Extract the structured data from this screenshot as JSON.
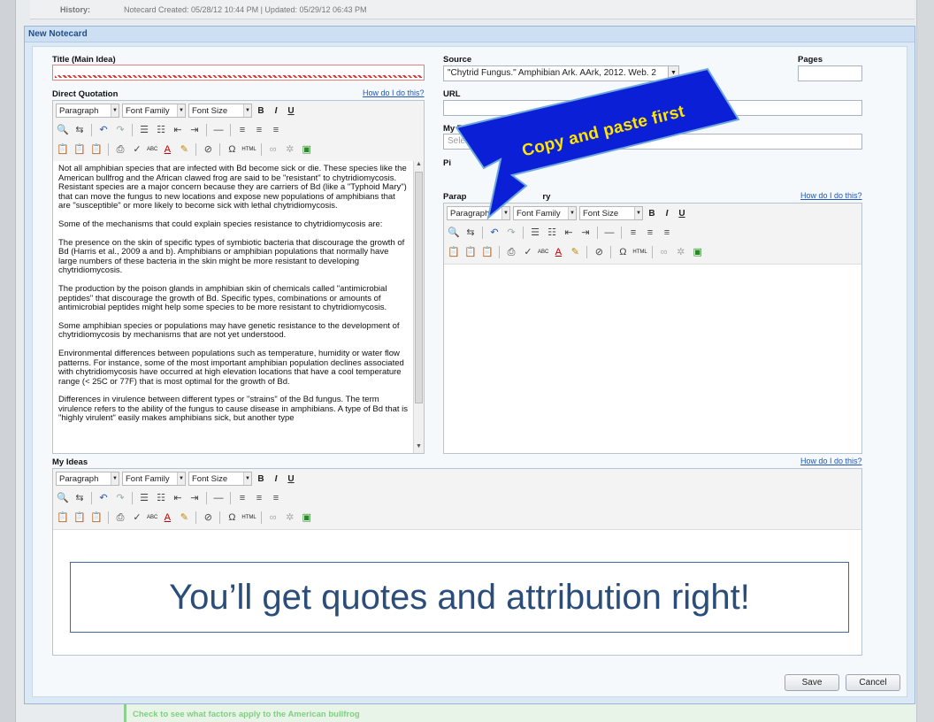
{
  "history": {
    "label": "History:",
    "text": "Notecard Created: 05/28/12 10:44 PM | Updated: 05/29/12 06:43 PM"
  },
  "modal": {
    "title": "New Notecard"
  },
  "title_field": {
    "label": "Title (Main Idea)",
    "value": ""
  },
  "direct_quotation": {
    "label": "Direct Quotation",
    "help": "How do I do this?",
    "paragraphs": [
      "Not all amphibian species that are infected with Bd become sick or die. These species like the American bullfrog and the African clawed frog are said to be \"resistant\" to chytridiomycosis. Resistant species are a major concern because they are carriers of Bd (like a \"Typhoid Mary\") that can move the fungus to new locations and expose new populations of amphibians that are \"susceptible\" or more likely to become sick with lethal chytridiomycosis.",
      "Some of the mechanisms that could explain species resistance to chytridiomycosis are:",
      "The presence on the skin of specific types of symbiotic bacteria that discourage the growth of Bd (Harris et al., 2009 a and b). Amphibians or amphibian populations that normally have large numbers of these bacteria in the skin might be more resistant to developing chytridiomycosis.",
      "The production by the poison glands in amphibian skin of chemicals called \"antimicrobial peptides\" that discourage the growth of Bd. Specific types, combinations or amounts of antimicrobial peptides might help some species to be more resistant to chytridiomycosis.",
      "Some amphibian species or populations may have genetic resistance to the development of chytridiomycosis by mechanisms that are not yet understood.",
      "Environmental differences between populations such as temperature, humidity or water flow patterns. For instance, some of the most important amphibian population declines associated with chytridiomycosis have occurred at high elevation locations that have a cool temperature range (< 25C or 77F) that is most optimal for the growth of Bd.",
      "Differences in virulence between different types or \"strains\" of the Bd fungus. The term virulence refers to the ability of the fungus to cause disease in amphibians. A type of Bd that is \"highly virulent\" easily makes amphibians sick, but another type"
    ]
  },
  "toolbar": {
    "format": "Paragraph",
    "font_family": "Font Family",
    "font_size": "Font Size",
    "bold": "B",
    "italic": "I",
    "underline": "U",
    "html": "HTML",
    "abc": "ABC"
  },
  "source": {
    "label": "Source",
    "value": "\"Chytrid Fungus.\" Amphibian Ark. AArk, 2012. Web. 2"
  },
  "pages": {
    "label": "Pages",
    "value": ""
  },
  "url": {
    "label": "URL",
    "value": ""
  },
  "tags": {
    "label": "My Tags",
    "placeholder": "Sele"
  },
  "pile": {
    "label": "Pi"
  },
  "paraphrase": {
    "label": "Parap",
    "label_tail": "ry",
    "help": "How do I do this?"
  },
  "my_ideas": {
    "label": "My Ideas",
    "help": "How do I do this?"
  },
  "annotations": {
    "arrow_text": "Copy and paste first",
    "bottom_text": "You’ll get quotes and attribution right!"
  },
  "buttons": {
    "save": "Save",
    "cancel": "Cancel"
  },
  "footer": {
    "text": "Check to see what factors apply to the American bullfrog"
  },
  "colors": {
    "arrow_fill": "#0a1fd6",
    "arrow_text": "#ffe500",
    "link": "#1f56b8",
    "modal_bg": "#dbe8f6"
  }
}
